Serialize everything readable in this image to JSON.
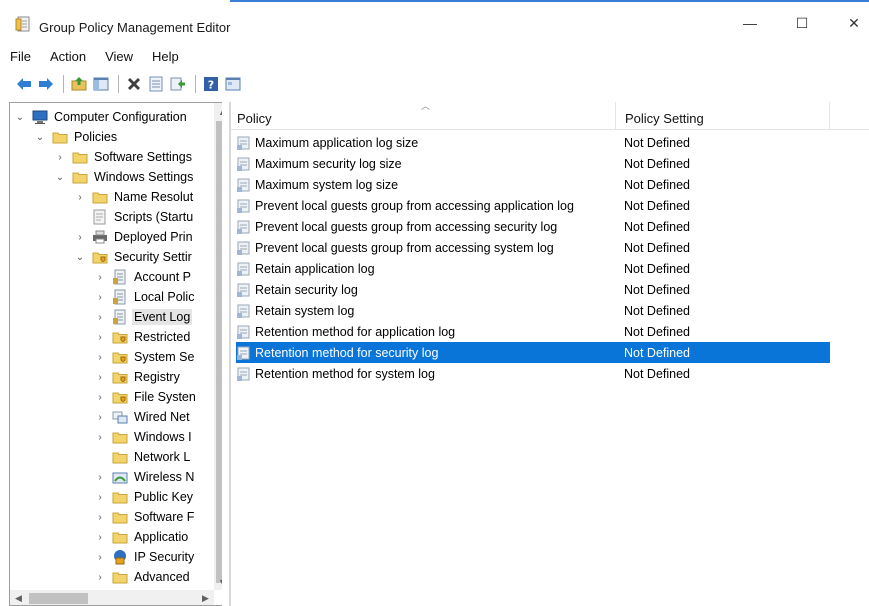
{
  "window": {
    "title": "Group Policy Management Editor",
    "controls": {
      "minimize": "—",
      "maximize": "☐",
      "close": "✕"
    }
  },
  "menu": [
    "File",
    "Action",
    "View",
    "Help"
  ],
  "toolbar": [
    "back-icon",
    "forward-icon",
    "up-folder-icon",
    "show-hide-tree-icon",
    "delete-icon",
    "properties-icon",
    "export-icon",
    "help-icon",
    "view-icon"
  ],
  "tree": {
    "root": {
      "label": "Computer Configuration",
      "expander": "⌄"
    },
    "items": [
      {
        "label": "Policies",
        "expander": "⌄",
        "icon": "folder-icon"
      },
      {
        "label": "Software Settings",
        "expander": "›",
        "icon": "folder-icon"
      },
      {
        "label": "Windows Settings",
        "expander": "⌄",
        "icon": "folder-icon"
      },
      {
        "label": "Name Resolut",
        "expander": "›",
        "icon": "folder-icon"
      },
      {
        "label": "Scripts (Startu",
        "expander": "",
        "icon": "script-icon"
      },
      {
        "label": "Deployed Prin",
        "expander": "›",
        "icon": "printer-icon"
      },
      {
        "label": "Security Settir",
        "expander": "⌄",
        "icon": "security-icon"
      },
      {
        "label": "Account P",
        "expander": "›",
        "icon": "policy-icon"
      },
      {
        "label": "Local Polic",
        "expander": "›",
        "icon": "policy-icon"
      },
      {
        "label": "Event Log",
        "expander": "›",
        "icon": "policy-icon"
      },
      {
        "label": "Restricted",
        "expander": "›",
        "icon": "security-icon"
      },
      {
        "label": "System Se",
        "expander": "›",
        "icon": "security-icon"
      },
      {
        "label": "Registry",
        "expander": "›",
        "icon": "security-icon"
      },
      {
        "label": "File Systen",
        "expander": "›",
        "icon": "security-icon"
      },
      {
        "label": "Wired Net",
        "expander": "›",
        "icon": "network-icon"
      },
      {
        "label": "Windows I",
        "expander": "›",
        "icon": "folder-icon"
      },
      {
        "label": "Network L",
        "expander": "",
        "icon": "folder-icon"
      },
      {
        "label": "Wireless N",
        "expander": "›",
        "icon": "wireless-icon"
      },
      {
        "label": "Public Key",
        "expander": "›",
        "icon": "folder-icon"
      },
      {
        "label": "Software F",
        "expander": "›",
        "icon": "folder-icon"
      },
      {
        "label": "Applicatio",
        "expander": "›",
        "icon": "folder-icon"
      },
      {
        "label": "IP Security",
        "expander": "›",
        "icon": "ip-security-icon"
      },
      {
        "label": "Advanced",
        "expander": "›",
        "icon": "folder-icon"
      }
    ]
  },
  "columns": {
    "policy": "Policy",
    "setting": "Policy Setting"
  },
  "policies": [
    {
      "policy": "Maximum application log size",
      "setting": "Not Defined"
    },
    {
      "policy": "Maximum security log size",
      "setting": "Not Defined"
    },
    {
      "policy": "Maximum system log size",
      "setting": "Not Defined"
    },
    {
      "policy": "Prevent local guests group from accessing application log",
      "setting": "Not Defined"
    },
    {
      "policy": "Prevent local guests group from accessing security log",
      "setting": "Not Defined"
    },
    {
      "policy": "Prevent local guests group from accessing system log",
      "setting": "Not Defined"
    },
    {
      "policy": "Retain application log",
      "setting": "Not Defined"
    },
    {
      "policy": "Retain security log",
      "setting": "Not Defined"
    },
    {
      "policy": "Retain system log",
      "setting": "Not Defined"
    },
    {
      "policy": "Retention method for application log",
      "setting": "Not Defined"
    },
    {
      "policy": "Retention method for security log",
      "setting": "Not Defined"
    },
    {
      "policy": "Retention method for system log",
      "setting": "Not Defined"
    }
  ],
  "colors": {
    "selection": "#0a75d8",
    "accent": "#3c7fd6"
  }
}
